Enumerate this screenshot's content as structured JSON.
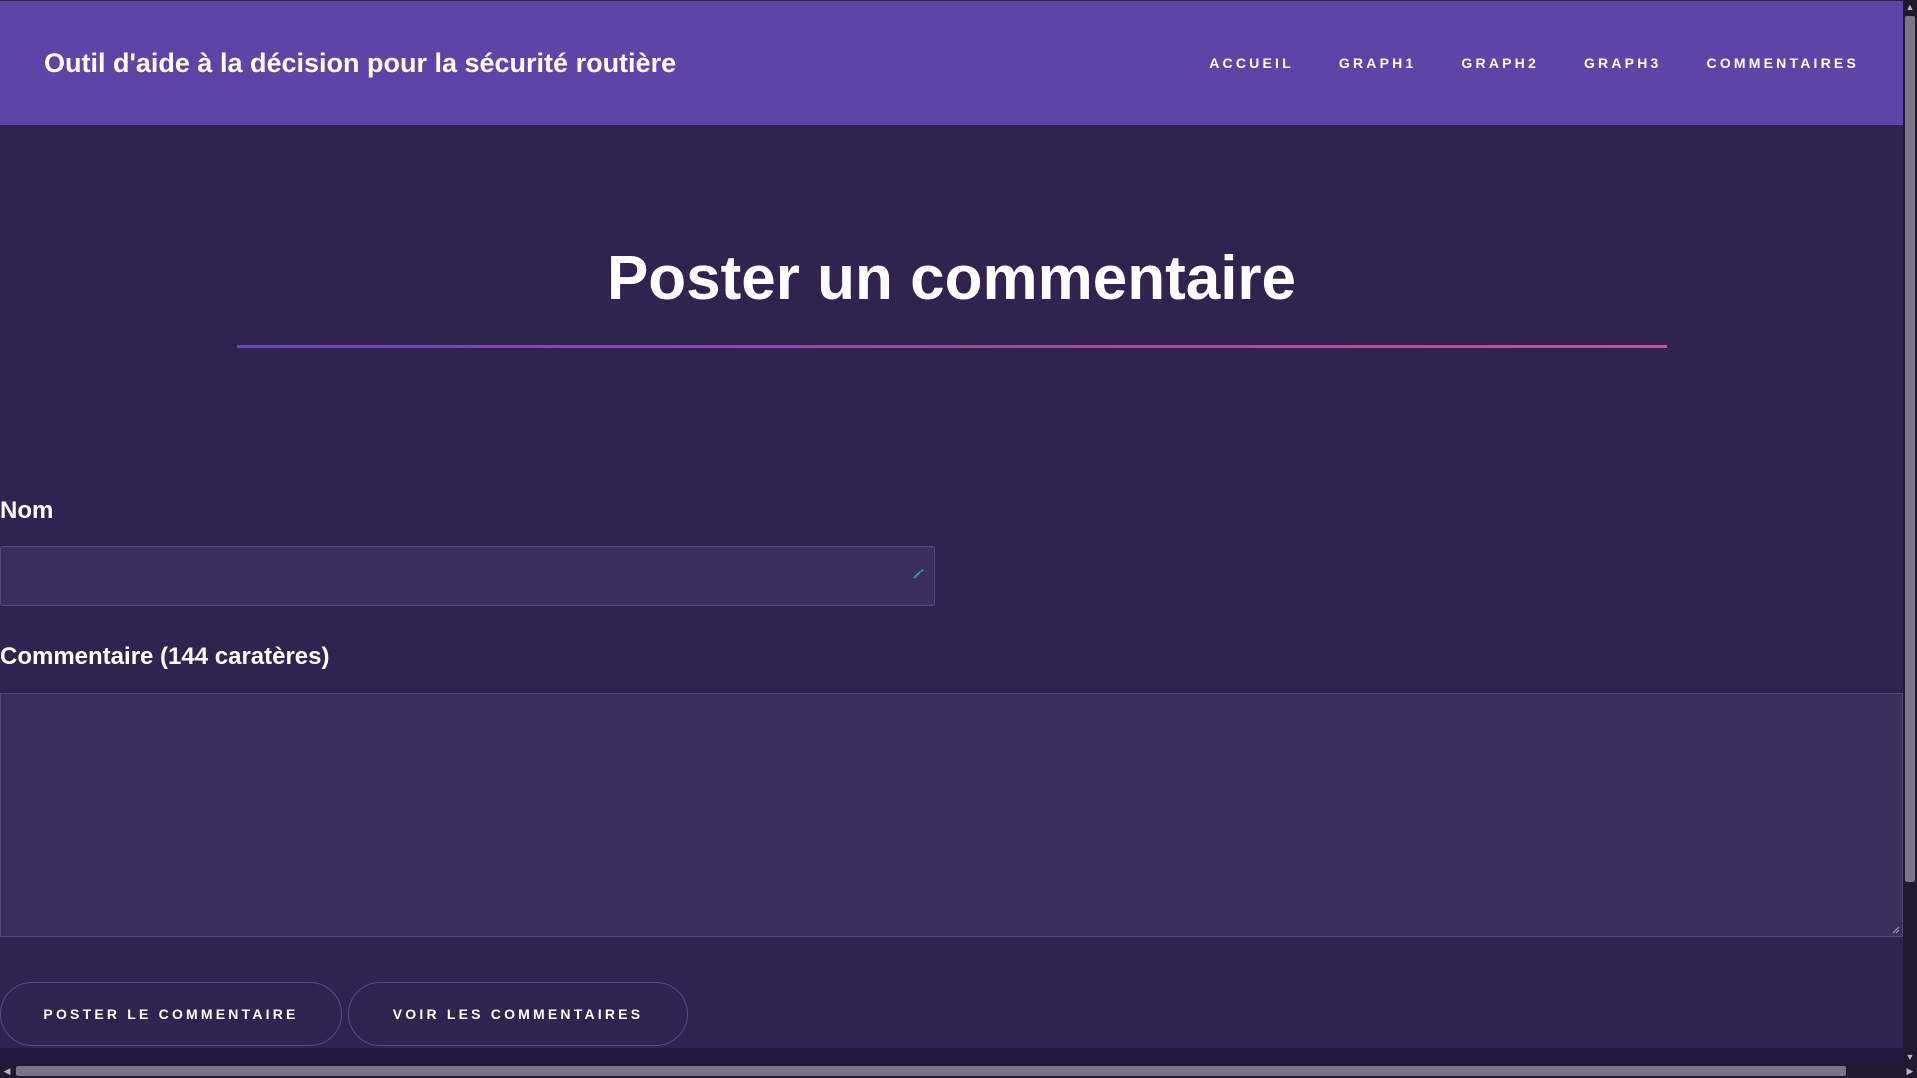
{
  "header": {
    "title": "Outil d'aide à la décision pour la sécurité routière",
    "nav": [
      {
        "label": "ACCUEIL"
      },
      {
        "label": "GRAPH1"
      },
      {
        "label": "GRAPH2"
      },
      {
        "label": "GRAPH3"
      },
      {
        "label": "COMMENTAIRES"
      }
    ]
  },
  "main": {
    "heading": "Poster un commentaire",
    "form": {
      "name_label": "Nom",
      "name_value": "",
      "comment_label": "Commentaire (144 caratères)",
      "comment_value": "",
      "post_button": "POSTER LE COMMENTAIRE",
      "view_button": "VOIR LES COMMENTAIRES"
    }
  },
  "icons": {
    "input_assist": "autofill-key-icon",
    "resize": "resize-grip-icon"
  },
  "colors": {
    "header_bg": "#5f44a8",
    "page_bg": "#312350",
    "field_bg": "#3c2e5c",
    "text": "#ffffff"
  }
}
